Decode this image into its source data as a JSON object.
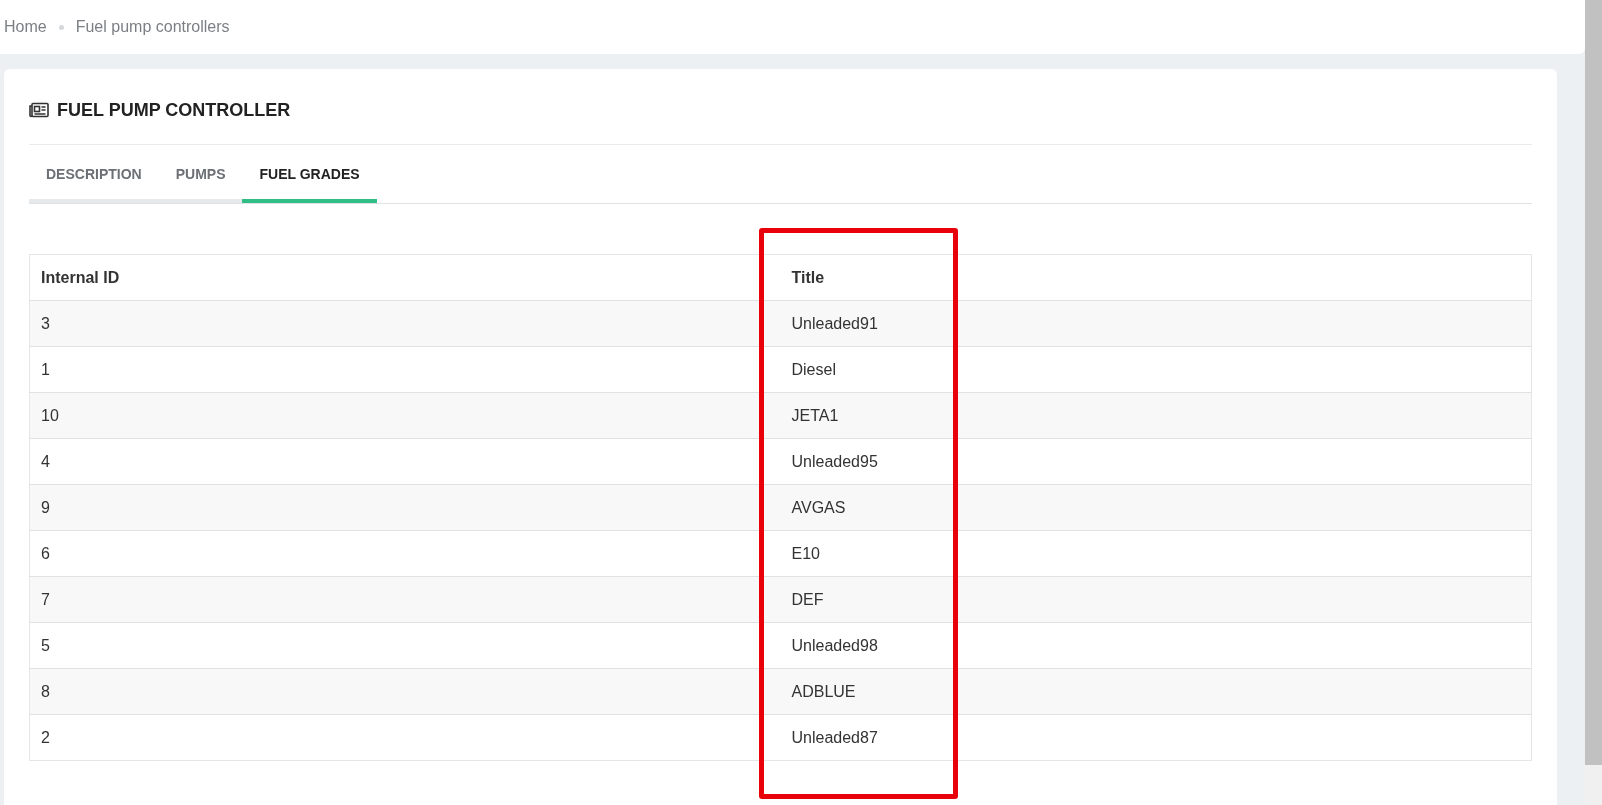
{
  "breadcrumb": [
    "Home",
    "Fuel pump controllers"
  ],
  "card": {
    "title": "FUEL PUMP CONTROLLER"
  },
  "tabs": [
    {
      "label": "DESCRIPTION",
      "selected": false
    },
    {
      "label": "PUMPS",
      "selected": false
    },
    {
      "label": "FUEL GRADES",
      "selected": true
    }
  ],
  "table": {
    "columns": [
      {
        "label": "Internal ID",
        "highlighted": false
      },
      {
        "label": "Title",
        "highlighted": true
      }
    ],
    "rows": [
      [
        "3",
        "Unleaded91"
      ],
      [
        "1",
        "Diesel"
      ],
      [
        "10",
        "JETA1"
      ],
      [
        "4",
        "Unleaded95"
      ],
      [
        "9",
        "AVGAS"
      ],
      [
        "6",
        "E10"
      ],
      [
        "7",
        "DEF"
      ],
      [
        "5",
        "Unleaded98"
      ],
      [
        "8",
        "ADBLUE"
      ],
      [
        "2",
        "Unleaded87"
      ]
    ]
  }
}
